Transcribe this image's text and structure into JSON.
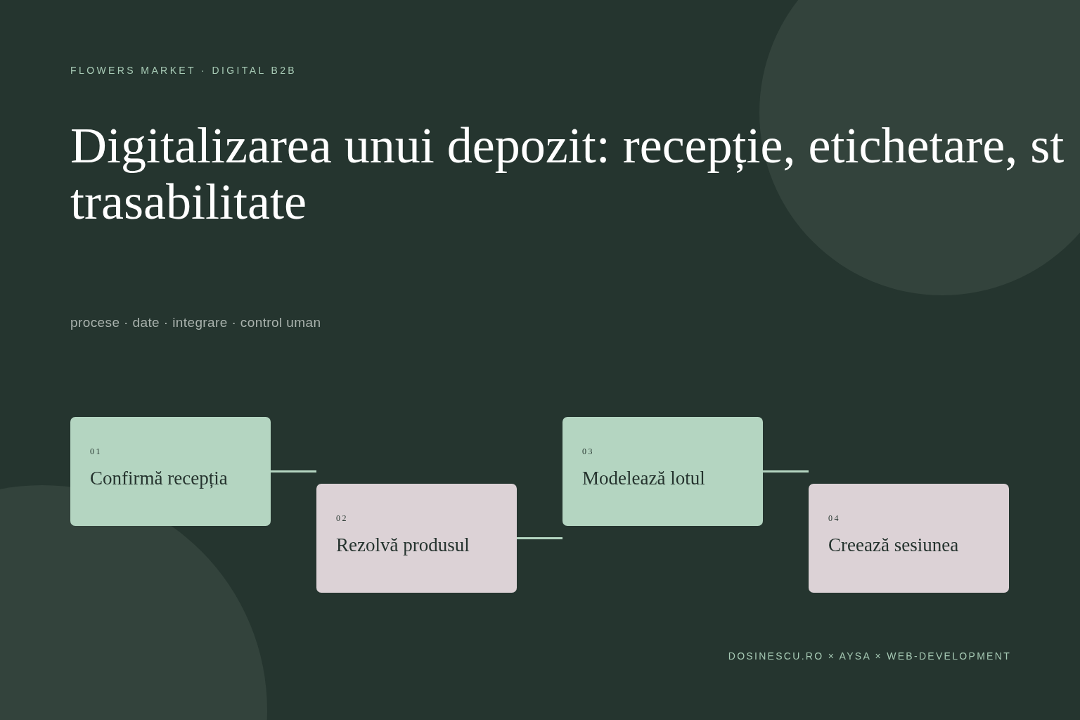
{
  "eyebrow": "FLOWERS MARKET · DIGITAL B2B",
  "title": {
    "lines": [
      "Digitalizarea unui depozit: recepție, etichetare, st",
      "trasabilitate"
    ]
  },
  "subtitle": "procese · date · integrare · control uman",
  "steps": [
    {
      "number": "01",
      "label": "Confirmă recepția",
      "color": "#b4d5c1"
    },
    {
      "number": "02",
      "label": "Rezolvă produsul",
      "color": "#dcd2d6"
    },
    {
      "number": "03",
      "label": "Modelează lotul",
      "color": "#b4d5c1"
    },
    {
      "number": "04",
      "label": "Creează sesiunea",
      "color": "#dcd2d6"
    }
  ],
  "footer": "DOSINESCU.RO × AYSA × WEB-DEVELOPMENT"
}
